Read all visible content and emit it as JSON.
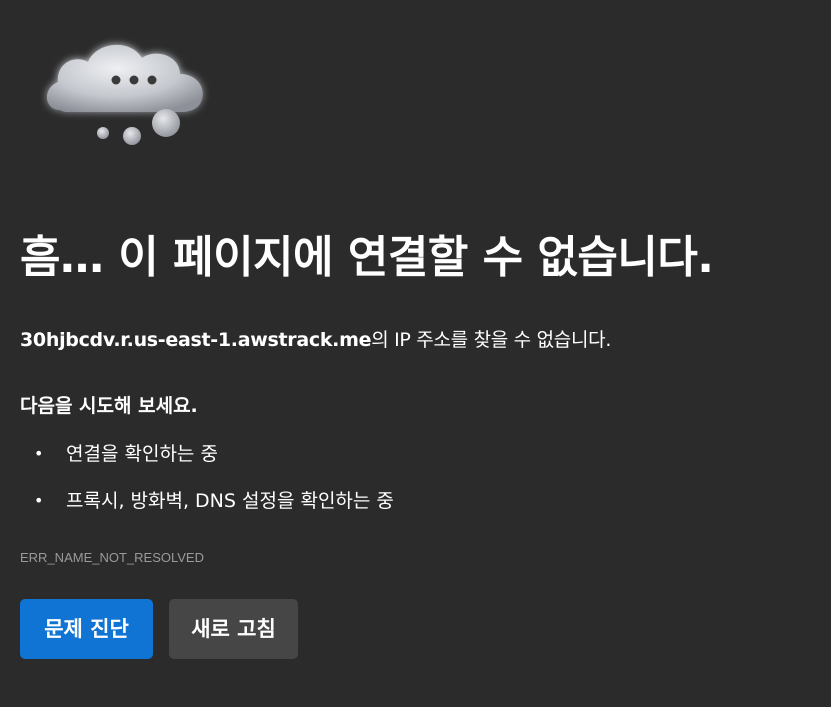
{
  "illustration": {
    "icon": "cloud-thinking-icon",
    "colors": {
      "cloud": "#c9ccd2",
      "dots": "#3a3a3a"
    }
  },
  "headline": "흠… 이 페이지에 연결할 수 없습니다.",
  "message": {
    "host": "30hjbcdv.r.us-east-1.awstrack.me",
    "suffix": "의 IP 주소를 찾을 수 없습니다."
  },
  "suggestions": {
    "heading": "다음을 시도해 보세요.",
    "bullet": "•",
    "items": [
      "연결을 확인하는 중",
      "프록시, 방화벽, DNS 설정을 확인하는 중"
    ]
  },
  "error_code": "ERR_NAME_NOT_RESOLVED",
  "buttons": {
    "diagnose": "문제 진단",
    "refresh": "새로 고침"
  },
  "colors": {
    "background": "#2b2b2b",
    "primary_button": "#0f74d4",
    "secondary_button": "#464646",
    "error_code_text": "#9a9a9a"
  }
}
